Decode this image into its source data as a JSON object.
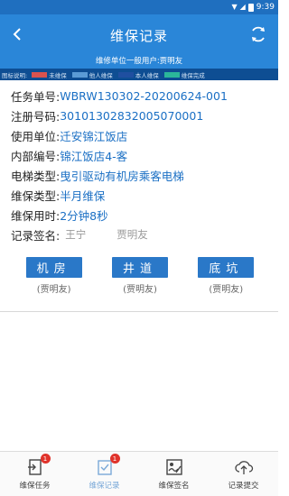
{
  "status_bar": {
    "time": "9:39"
  },
  "header": {
    "title": "维保记录",
    "subtitle": "维修单位一般用户:贾明友"
  },
  "legend": {
    "label": "图标说明:",
    "items": [
      {
        "color": "#d9534f",
        "label": "未维保"
      },
      {
        "color": "#5b9bd5",
        "label": "他人维保"
      },
      {
        "color": "#1f4fa0",
        "label": "本人维保"
      },
      {
        "color": "#2bb79a",
        "label": "维保完成"
      }
    ]
  },
  "record": {
    "task_no_label": "任务单号:",
    "task_no": "WBRW130302-20200624-001",
    "reg_no_label": "注册号码:",
    "reg_no": "30101302832005070001",
    "unit_label": "使用单位:",
    "unit": "迁安锦江饭店",
    "internal_no_label": "内部编号:",
    "internal_no": "锦江饭店4-客",
    "elevator_type_label": "电梯类型:",
    "elevator_type": "曳引驱动有机房乘客电梯",
    "maint_type_label": "维保类型:",
    "maint_type": "半月维保",
    "duration_label": "维保用时:",
    "duration": "2分钟8秒",
    "signature_label": "记录签名:",
    "signature_1": "王宁",
    "signature_2": "贾明友"
  },
  "sections": [
    {
      "label": "机房",
      "signer": "(贾明友)"
    },
    {
      "label": "井道",
      "signer": "(贾明友)"
    },
    {
      "label": "底坑",
      "signer": "(贾明友)"
    }
  ],
  "bottom_nav": [
    {
      "label": "维保任务",
      "badge": "1",
      "icon": "task-icon"
    },
    {
      "label": "维保记录",
      "badge": "1",
      "icon": "record-icon"
    },
    {
      "label": "维保签名",
      "badge": "",
      "icon": "signature-icon"
    },
    {
      "label": "记录提交",
      "badge": "",
      "icon": "upload-cloud-icon"
    }
  ]
}
